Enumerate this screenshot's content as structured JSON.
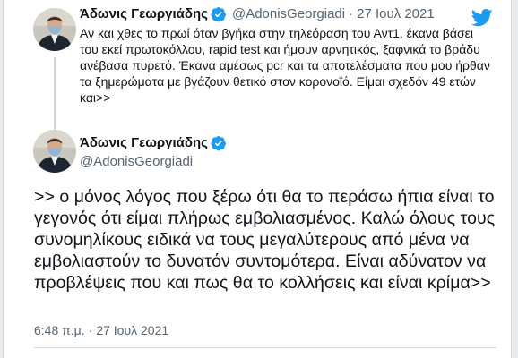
{
  "colors": {
    "brand_blue": "#1d9bf0",
    "text_primary": "#0f1419",
    "text_secondary": "#536471",
    "divider": "#cfd9de"
  },
  "icons": {
    "brand": "twitter-bird-icon",
    "verified": "verified-badge-icon"
  },
  "parent_tweet": {
    "author_name": "Άδωνις Γεωργιάδης",
    "handle": "@AdonisGeorgiadi",
    "separator": "·",
    "date": "27 Ιουλ 2021",
    "text": "Αν και χθες το πρωί όταν βγήκα στην τηλεόραση του Αντ1, έκανα βάσει του εκεί πρωτοκόλλου, rapid test και ήμουν αρνητικός, ξαφνικά το βράδυ ανέβασα πυρετό. Έκανα αμέσως pcr και τα αποτελέσματα που μου ήρθαν τα ξημερώματα με βγάζουν θετικό στον κορονοϊό. Είμαι σχεδόν 49 ετών και>>"
  },
  "main_tweet": {
    "author_name": "Άδωνις Γεωργιάδης",
    "handle": "@AdonisGeorgiadi",
    "text": ">> ο μόνος λόγος που ξέρω ότι θα το περάσω ήπια είναι το γεγονός ότι είμαι πλήρως εμβολιασμένος. Καλώ όλους τους συνομηλίκους ειδικά να τους μεγαλύτερους από μένα να εμβολιαστούν το δυνατόν συντομότερα. Είναι αδύνατον να προβλέψεις που και πως θα το κολλήσεις και είναι κρίμα>>",
    "time": "6:48 π.μ.",
    "separator": "·",
    "date": "27 Ιουλ 2021"
  }
}
